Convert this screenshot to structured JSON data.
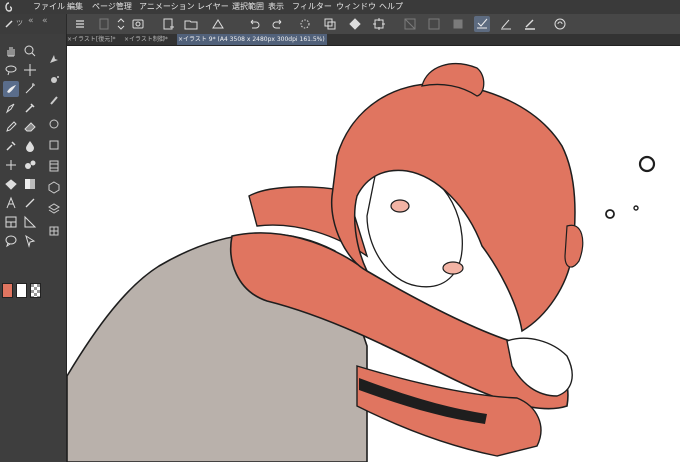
{
  "menu": {
    "items": [
      "ファイル",
      "編集",
      "ページ管理",
      "アニメーション",
      "レイヤー",
      "選択範囲",
      "表示",
      "フィルター",
      "ウィンドウ",
      "ヘルプ"
    ]
  },
  "tabs": [
    {
      "label": "イラスト[復元]*",
      "active": false
    },
    {
      "label": "イラスト制御*",
      "active": false
    },
    {
      "label": "イラスト 9* (A4 3508 x 2480px 300dpi 161.5%)",
      "active": true
    }
  ],
  "palette_header": {
    "collapse_label": "«",
    "collapse_label_right": "«"
  },
  "colors": {
    "main_color": "#e07560",
    "sub_color": "#ffffff",
    "ui_accent": "#5a6d8b",
    "hair": "#e07560",
    "sleeve": "#e07560",
    "shirt": "#b9b1ab",
    "line": "#1e1e1e"
  },
  "icons": {
    "command_bar": [
      "menu-icon",
      "new-icon",
      "chevron-updown-icon",
      "snapshot-icon",
      "new-canvas-icon",
      "open-icon",
      "save-icon",
      "undo-icon",
      "redo-icon",
      "ruler-icon",
      "layer-icon",
      "fill-icon",
      "transform-icon",
      "hide-icon",
      "copy-icon",
      "paste-icon",
      "check-icon",
      "brush-icon",
      "pen-icon",
      "settings-icon"
    ],
    "tools": [
      "hand-icon",
      "zoom-icon",
      "lasso-icon",
      "move-icon",
      "brush-icon",
      "magic-wand-icon",
      "pen-icon",
      "eyedropper-icon",
      "pencil-icon",
      "eraser-icon",
      "airbrush-icon",
      "blend-icon",
      "ink-icon",
      "shape-icon",
      "fill-icon",
      "gradient-icon",
      "text-icon",
      "line-icon",
      "frame-icon",
      "ruler-icon",
      "balloon-icon",
      "select-icon"
    ]
  }
}
